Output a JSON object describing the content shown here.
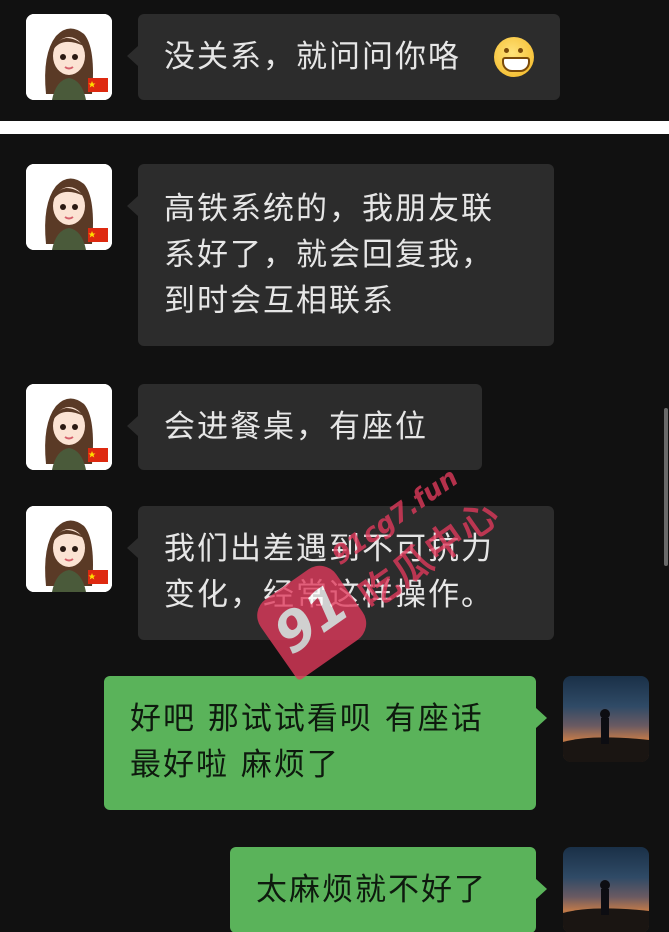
{
  "messages": [
    {
      "side": "in",
      "lines": [
        "没关系，就问问你咯"
      ],
      "emoji": "grinning-face-icon"
    },
    {
      "side": "in",
      "lines": [
        "高铁系统的，我朋友联",
        "系好了，就会回复我，",
        "到时会互相联系"
      ]
    },
    {
      "side": "in",
      "lines": [
        "会进餐桌，有座位"
      ]
    },
    {
      "side": "in",
      "lines": [
        "我们出差遇到不可抗力",
        "变化，经常这样操作。"
      ]
    },
    {
      "side": "out",
      "lines": [
        "好吧 那试试看呗 有座话",
        "最好啦 麻烦了"
      ]
    },
    {
      "side": "out",
      "lines": [
        "太麻烦就不好了"
      ]
    }
  ],
  "watermark": {
    "site": "91cg7.fun",
    "name": "吃瓜中心",
    "logo": "91"
  },
  "colors": {
    "background": "#111111",
    "incoming_bubble": "#2c2c2c",
    "outgoing_bubble": "#5ab35a",
    "watermark": "#e23a5c"
  }
}
